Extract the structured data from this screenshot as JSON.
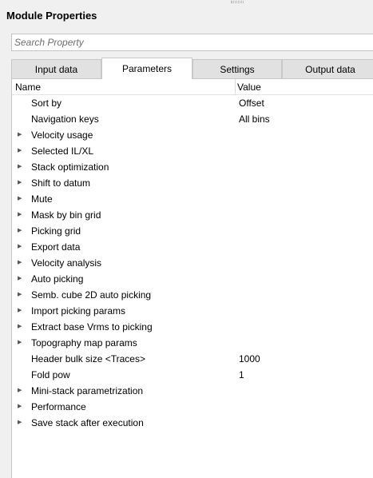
{
  "title": "Module Properties",
  "search": {
    "placeholder": "Search Property"
  },
  "tabs": [
    {
      "label": "Input data"
    },
    {
      "label": "Parameters"
    },
    {
      "label": "Settings"
    },
    {
      "label": "Output data"
    }
  ],
  "active_tab": "Parameters",
  "grid": {
    "header": {
      "name": "Name",
      "value": "Value"
    },
    "rows": [
      {
        "name": "Sort by",
        "value": "Offset",
        "expandable": false
      },
      {
        "name": "Navigation keys",
        "value": "All bins",
        "expandable": false
      },
      {
        "name": "Velocity usage",
        "value": "",
        "expandable": true
      },
      {
        "name": "Selected IL/XL",
        "value": "",
        "expandable": true
      },
      {
        "name": "Stack optimization",
        "value": "",
        "expandable": true
      },
      {
        "name": "Shift to datum",
        "value": "",
        "expandable": true
      },
      {
        "name": "Mute",
        "value": "",
        "expandable": true
      },
      {
        "name": "Mask by bin grid",
        "value": "",
        "expandable": true
      },
      {
        "name": "Picking grid",
        "value": "",
        "expandable": true
      },
      {
        "name": "Export data",
        "value": "",
        "expandable": true
      },
      {
        "name": "Velocity analysis",
        "value": "",
        "expandable": true
      },
      {
        "name": "Auto picking",
        "value": "",
        "expandable": true
      },
      {
        "name": "Semb. cube 2D auto picking",
        "value": "",
        "expandable": true
      },
      {
        "name": "Import picking params",
        "value": "",
        "expandable": true
      },
      {
        "name": "Extract base Vrms to picking",
        "value": "",
        "expandable": true
      },
      {
        "name": "Topography map params",
        "value": "",
        "expandable": true
      },
      {
        "name": "Header bulk size <Traces>",
        "value": "1000",
        "expandable": false
      },
      {
        "name": "Fold pow",
        "value": "1",
        "expandable": false
      },
      {
        "name": "Mini-stack parametrization",
        "value": "",
        "expandable": true
      },
      {
        "name": "Performance",
        "value": "",
        "expandable": true
      },
      {
        "name": "Save stack after execution",
        "value": "",
        "expandable": true
      }
    ]
  },
  "icons": {
    "expand": "chevron-right-icon"
  }
}
